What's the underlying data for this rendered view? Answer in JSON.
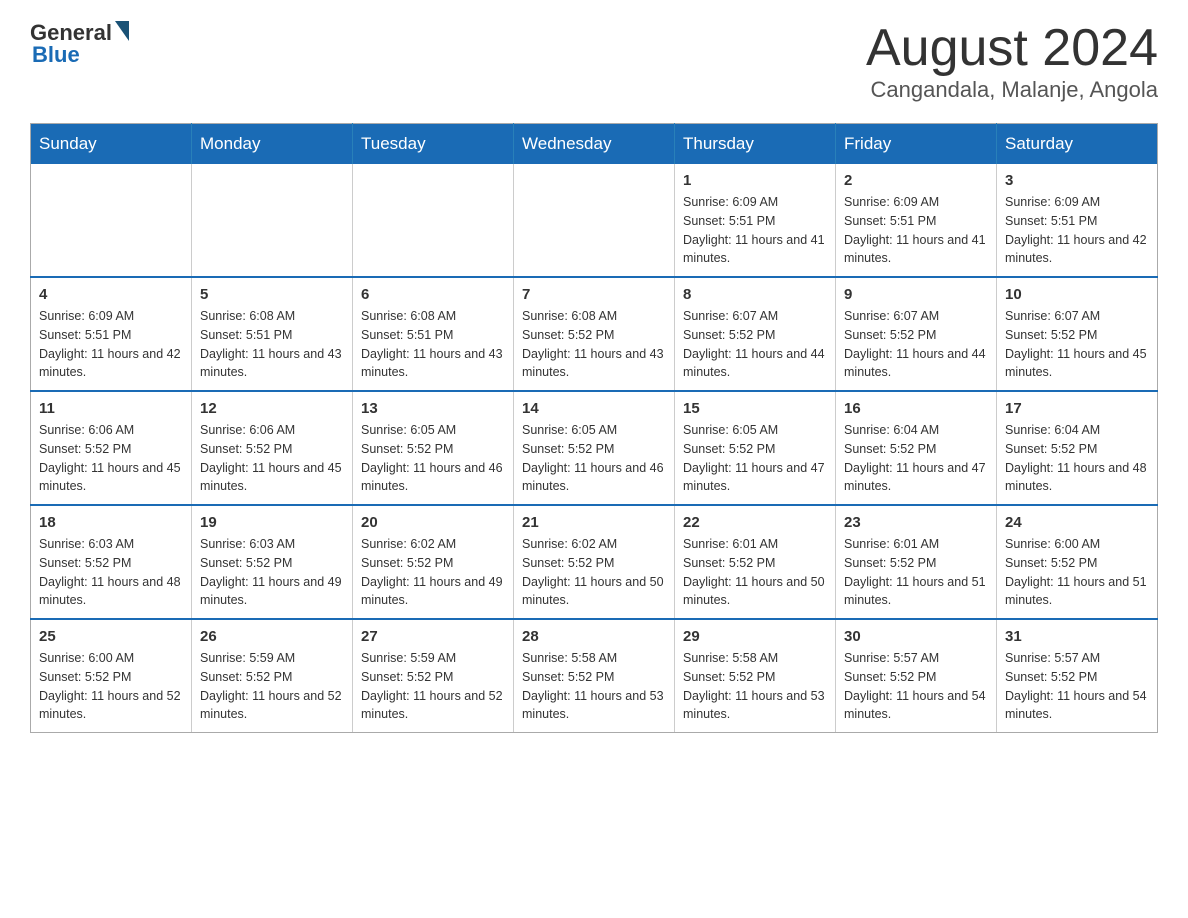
{
  "header": {
    "logo": {
      "general": "General",
      "blue": "Blue"
    },
    "title": "August 2024",
    "location": "Cangandala, Malanje, Angola"
  },
  "calendar": {
    "headers": [
      "Sunday",
      "Monday",
      "Tuesday",
      "Wednesday",
      "Thursday",
      "Friday",
      "Saturday"
    ],
    "weeks": [
      [
        {
          "day": "",
          "info": ""
        },
        {
          "day": "",
          "info": ""
        },
        {
          "day": "",
          "info": ""
        },
        {
          "day": "",
          "info": ""
        },
        {
          "day": "1",
          "info": "Sunrise: 6:09 AM\nSunset: 5:51 PM\nDaylight: 11 hours and 41 minutes."
        },
        {
          "day": "2",
          "info": "Sunrise: 6:09 AM\nSunset: 5:51 PM\nDaylight: 11 hours and 41 minutes."
        },
        {
          "day": "3",
          "info": "Sunrise: 6:09 AM\nSunset: 5:51 PM\nDaylight: 11 hours and 42 minutes."
        }
      ],
      [
        {
          "day": "4",
          "info": "Sunrise: 6:09 AM\nSunset: 5:51 PM\nDaylight: 11 hours and 42 minutes."
        },
        {
          "day": "5",
          "info": "Sunrise: 6:08 AM\nSunset: 5:51 PM\nDaylight: 11 hours and 43 minutes."
        },
        {
          "day": "6",
          "info": "Sunrise: 6:08 AM\nSunset: 5:51 PM\nDaylight: 11 hours and 43 minutes."
        },
        {
          "day": "7",
          "info": "Sunrise: 6:08 AM\nSunset: 5:52 PM\nDaylight: 11 hours and 43 minutes."
        },
        {
          "day": "8",
          "info": "Sunrise: 6:07 AM\nSunset: 5:52 PM\nDaylight: 11 hours and 44 minutes."
        },
        {
          "day": "9",
          "info": "Sunrise: 6:07 AM\nSunset: 5:52 PM\nDaylight: 11 hours and 44 minutes."
        },
        {
          "day": "10",
          "info": "Sunrise: 6:07 AM\nSunset: 5:52 PM\nDaylight: 11 hours and 45 minutes."
        }
      ],
      [
        {
          "day": "11",
          "info": "Sunrise: 6:06 AM\nSunset: 5:52 PM\nDaylight: 11 hours and 45 minutes."
        },
        {
          "day": "12",
          "info": "Sunrise: 6:06 AM\nSunset: 5:52 PM\nDaylight: 11 hours and 45 minutes."
        },
        {
          "day": "13",
          "info": "Sunrise: 6:05 AM\nSunset: 5:52 PM\nDaylight: 11 hours and 46 minutes."
        },
        {
          "day": "14",
          "info": "Sunrise: 6:05 AM\nSunset: 5:52 PM\nDaylight: 11 hours and 46 minutes."
        },
        {
          "day": "15",
          "info": "Sunrise: 6:05 AM\nSunset: 5:52 PM\nDaylight: 11 hours and 47 minutes."
        },
        {
          "day": "16",
          "info": "Sunrise: 6:04 AM\nSunset: 5:52 PM\nDaylight: 11 hours and 47 minutes."
        },
        {
          "day": "17",
          "info": "Sunrise: 6:04 AM\nSunset: 5:52 PM\nDaylight: 11 hours and 48 minutes."
        }
      ],
      [
        {
          "day": "18",
          "info": "Sunrise: 6:03 AM\nSunset: 5:52 PM\nDaylight: 11 hours and 48 minutes."
        },
        {
          "day": "19",
          "info": "Sunrise: 6:03 AM\nSunset: 5:52 PM\nDaylight: 11 hours and 49 minutes."
        },
        {
          "day": "20",
          "info": "Sunrise: 6:02 AM\nSunset: 5:52 PM\nDaylight: 11 hours and 49 minutes."
        },
        {
          "day": "21",
          "info": "Sunrise: 6:02 AM\nSunset: 5:52 PM\nDaylight: 11 hours and 50 minutes."
        },
        {
          "day": "22",
          "info": "Sunrise: 6:01 AM\nSunset: 5:52 PM\nDaylight: 11 hours and 50 minutes."
        },
        {
          "day": "23",
          "info": "Sunrise: 6:01 AM\nSunset: 5:52 PM\nDaylight: 11 hours and 51 minutes."
        },
        {
          "day": "24",
          "info": "Sunrise: 6:00 AM\nSunset: 5:52 PM\nDaylight: 11 hours and 51 minutes."
        }
      ],
      [
        {
          "day": "25",
          "info": "Sunrise: 6:00 AM\nSunset: 5:52 PM\nDaylight: 11 hours and 52 minutes."
        },
        {
          "day": "26",
          "info": "Sunrise: 5:59 AM\nSunset: 5:52 PM\nDaylight: 11 hours and 52 minutes."
        },
        {
          "day": "27",
          "info": "Sunrise: 5:59 AM\nSunset: 5:52 PM\nDaylight: 11 hours and 52 minutes."
        },
        {
          "day": "28",
          "info": "Sunrise: 5:58 AM\nSunset: 5:52 PM\nDaylight: 11 hours and 53 minutes."
        },
        {
          "day": "29",
          "info": "Sunrise: 5:58 AM\nSunset: 5:52 PM\nDaylight: 11 hours and 53 minutes."
        },
        {
          "day": "30",
          "info": "Sunrise: 5:57 AM\nSunset: 5:52 PM\nDaylight: 11 hours and 54 minutes."
        },
        {
          "day": "31",
          "info": "Sunrise: 5:57 AM\nSunset: 5:52 PM\nDaylight: 11 hours and 54 minutes."
        }
      ]
    ]
  }
}
